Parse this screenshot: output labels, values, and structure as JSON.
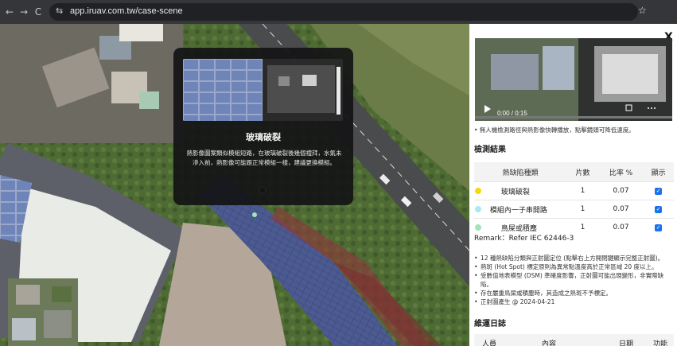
{
  "browser": {
    "url": "app.iruav.com.tw/case-scene",
    "back_icon": "←",
    "forward_icon": "→",
    "reload_icon": "C",
    "site_icon": "⇆",
    "star_icon": "☆"
  },
  "popup": {
    "title": "玻璃破裂",
    "description": "熱影像圖案類似模組短路，在玻璃破裂後幾個禮拜，水氣未滲入前，熱影像可能跟正常模組一樣，建議更換模組。"
  },
  "video": {
    "time": "0:00 / 0:15",
    "close_icon": "X"
  },
  "panel": {
    "video_note": "無人機檢測路徑與熱影像快轉播放，點擊鏡頭可降低速度。",
    "results_title": "檢測結果",
    "table_headers": [
      "熱缺陷種類",
      "片數",
      "比率 %",
      "顯示"
    ],
    "rows": [
      {
        "color": "#f5d90a",
        "type": "玻璃破裂",
        "count": "1",
        "ratio": "0.07"
      },
      {
        "color": "#a9e9ef",
        "type": "模組內一子串開路",
        "count": "1",
        "ratio": "0.07"
      },
      {
        "color": "#9fe6b8",
        "type": "鳥屎或積塵",
        "count": "1",
        "ratio": "0.07"
      }
    ],
    "remark": "Remark：Refer IEC 62446-3",
    "notes": [
      "12 種熱缺陷分類與正射圖定位 (點擊右上方開閉鍵顯示完整正射圖)。",
      "熱斑 (Hot Spot) 標定原則為異常點溫度高於正常區域 20 度以上。",
      "受數值地表模型 (DSM) 準確度影響，正射圖可能出現變形，非實際缺陷。",
      "存在嚴重鳥屎或積塵時，其造成之熱斑不予標定。",
      "正射圖產生 @ 2024-04-21"
    ],
    "log_title": "維運日誌",
    "log_headers": [
      "人員",
      "內容",
      "日期",
      "功能"
    ]
  }
}
